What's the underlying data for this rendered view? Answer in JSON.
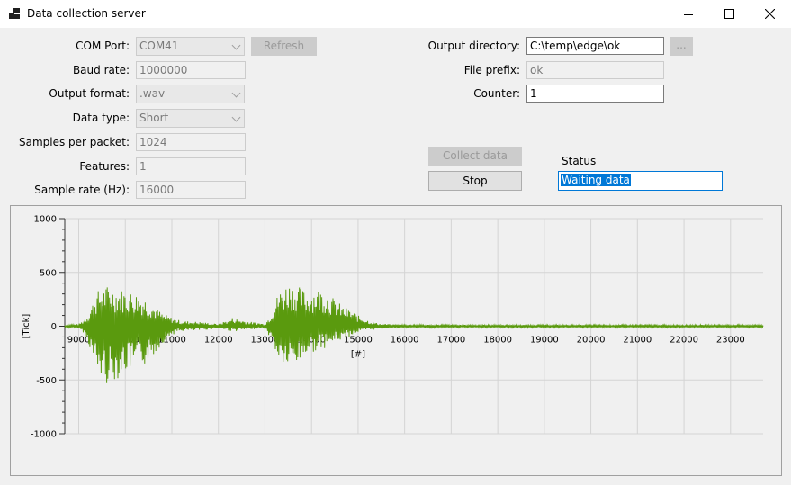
{
  "window": {
    "title": "Data collection server",
    "minimize_icon": "minimize-icon",
    "maximize_icon": "maximize-icon",
    "close_icon": "close-icon"
  },
  "left_form": {
    "com_port": {
      "label": "COM Port:",
      "value": "COM41"
    },
    "refresh_label": "Refresh",
    "baud_rate": {
      "label": "Baud rate:",
      "value": "1000000"
    },
    "output_format": {
      "label": "Output format:",
      "value": ".wav"
    },
    "data_type": {
      "label": "Data type:",
      "value": "Short"
    },
    "samples_per_packet": {
      "label": "Samples per packet:",
      "value": "1024"
    },
    "features": {
      "label": "Features:",
      "value": "1"
    },
    "sample_rate": {
      "label": "Sample rate (Hz):",
      "value": "16000"
    }
  },
  "right_form": {
    "output_directory": {
      "label": "Output directory:",
      "value": "C:\\temp\\edge\\ok"
    },
    "browse_label": "...",
    "file_prefix": {
      "label": "File prefix:",
      "value": "ok"
    },
    "counter": {
      "label": "Counter:",
      "value": "1"
    }
  },
  "actions": {
    "collect_label": "Collect data",
    "stop_label": "Stop"
  },
  "status": {
    "label": "Status",
    "value": "Waiting data"
  },
  "chart_data": {
    "type": "line",
    "xlabel": "[#]",
    "ylabel": "[Tick]",
    "xlim": [
      8700,
      23700
    ],
    "ylim": [
      -1000,
      1000
    ],
    "x_ticks": [
      9000,
      10000,
      11000,
      12000,
      13000,
      14000,
      15000,
      16000,
      17000,
      18000,
      19000,
      20000,
      21000,
      22000,
      23000
    ],
    "y_ticks": [
      1000,
      500,
      0,
      -500,
      -1000
    ],
    "grid": true,
    "line_color": "#5a9a0e",
    "envelope": {
      "x": [
        8700,
        9000,
        9100,
        9200,
        9400,
        9600,
        9800,
        10000,
        10200,
        10400,
        10600,
        10800,
        11000,
        11200,
        11400,
        11600,
        11800,
        12000,
        12200,
        12300,
        12500,
        12700,
        12900,
        13000,
        13100,
        13300,
        13500,
        13700,
        13900,
        14100,
        14300,
        14500,
        14700,
        14900,
        15000,
        15200,
        15400,
        15600,
        16000,
        17000,
        23700
      ],
      "y": [
        10,
        20,
        60,
        120,
        330,
        380,
        360,
        340,
        320,
        280,
        200,
        120,
        80,
        50,
        45,
        40,
        30,
        20,
        60,
        80,
        60,
        40,
        30,
        20,
        100,
        330,
        420,
        380,
        320,
        360,
        340,
        250,
        180,
        140,
        100,
        60,
        30,
        20,
        15,
        12,
        12
      ]
    },
    "min_envelope": {
      "x": [
        8700,
        9000,
        9100,
        9200,
        9400,
        9600,
        9800,
        10000,
        10200,
        10400,
        10600,
        10800,
        11000,
        11200,
        11400,
        11600,
        11800,
        12000,
        12200,
        12300,
        12500,
        12700,
        12900,
        13000,
        13100,
        13300,
        13500,
        13700,
        13900,
        14100,
        14300,
        14500,
        14700,
        14900,
        15000,
        15200,
        15400,
        15600,
        16000,
        17000,
        23700
      ],
      "y": [
        -10,
        -20,
        -60,
        -150,
        -450,
        -540,
        -500,
        -430,
        -400,
        -370,
        -280,
        -160,
        -80,
        -50,
        -45,
        -40,
        -30,
        -20,
        -40,
        -50,
        -40,
        -30,
        -20,
        -20,
        -100,
        -330,
        -400,
        -360,
        -260,
        -230,
        -200,
        -150,
        -120,
        -80,
        -60,
        -40,
        -30,
        -20,
        -15,
        -12,
        -12
      ]
    }
  }
}
